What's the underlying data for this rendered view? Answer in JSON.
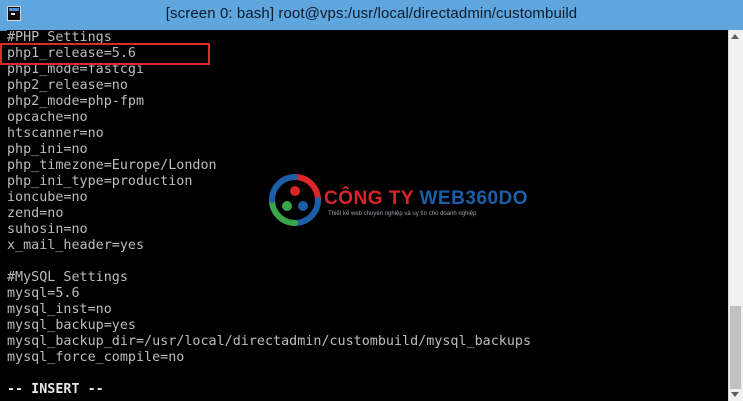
{
  "window": {
    "title": "[screen 0: bash] root@vps:/usr/local/directadmin/custombuild",
    "title_icon": "terminal-icon"
  },
  "terminal": {
    "lines": [
      "#PHP Settings",
      "php1_release=5.6",
      "php1_mode=fastcgi",
      "php2_release=no",
      "php2_mode=php-fpm",
      "opcache=no",
      "htscanner=no",
      "php_ini=no",
      "php_timezone=Europe/London",
      "php_ini_type=production",
      "ioncube=no",
      "zend=no",
      "suhosin=no",
      "x_mail_header=yes",
      "",
      "#MySQL Settings",
      "mysql=5.6",
      "mysql_inst=no",
      "mysql_backup=yes",
      "mysql_backup_dir=/usr/local/directadmin/custombuild/mysql_backups",
      "mysql_force_compile=no",
      "",
      "-- INSERT --"
    ],
    "highlighted_line": 1
  },
  "watermark": {
    "name_part1": "CÔNG TY ",
    "name_part2": "WEB360DO",
    "tagline": "Thiết kế web chuyên nghiệp và uy tín cho doanh nghiệp",
    "colors": {
      "red": "#d8262a",
      "blue": "#1b5fa8",
      "green": "#3aa64a"
    }
  },
  "colors": {
    "titlebar": "#5fa5de",
    "terminal_bg": "#000000",
    "terminal_text": "#bcbcbc",
    "highlight_border": "#e02a2a"
  }
}
